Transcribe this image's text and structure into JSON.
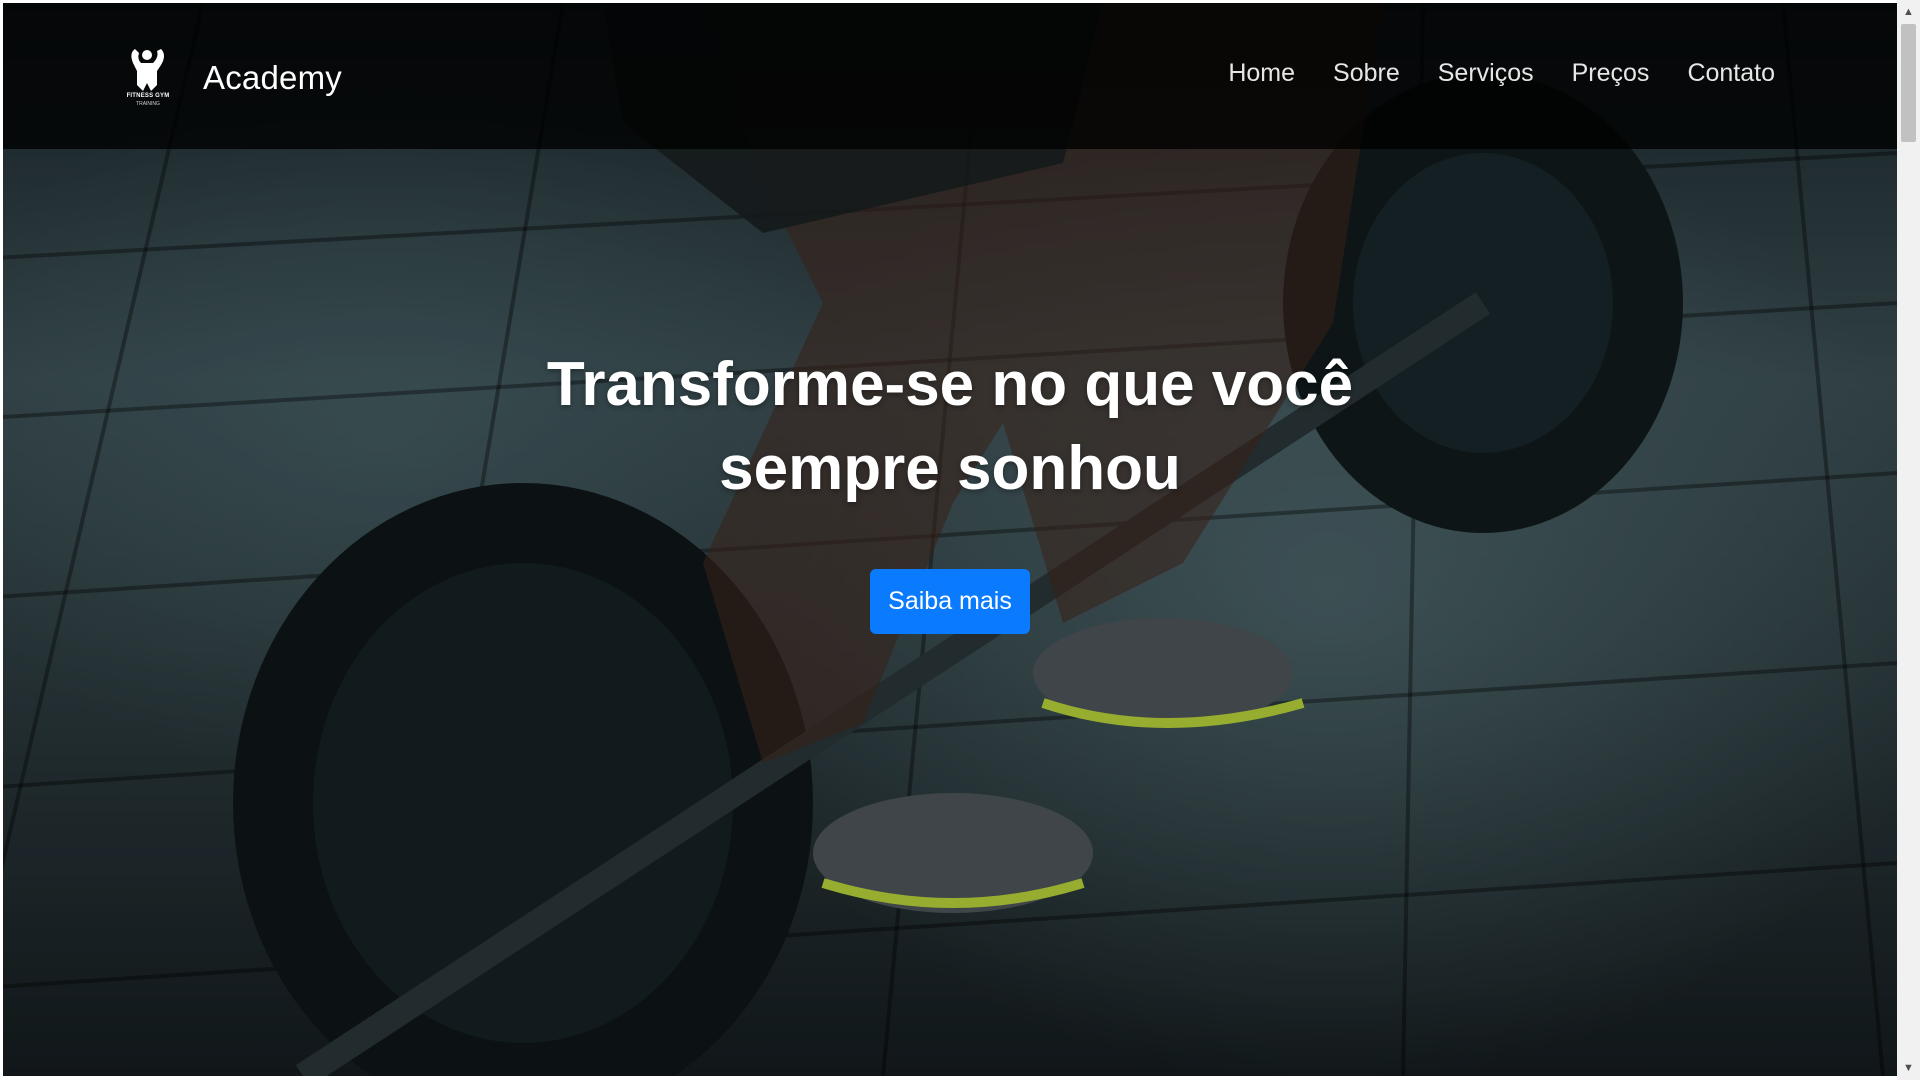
{
  "navbar": {
    "logo": {
      "icon": "bodybuilder-icon",
      "line1": "FITNESS GYM",
      "line2": "TRAINING"
    },
    "brand": "Academy",
    "links": [
      "Home",
      "Sobre",
      "Serviços",
      "Preços",
      "Contato"
    ]
  },
  "hero": {
    "title_line1": "Transforme-se no que você",
    "title_line2": "sempre sonhou",
    "cta_label": "Saiba mais",
    "cta_color": "#0a7bff"
  },
  "scrollbar": {
    "up_icon": "chevron-up-icon",
    "down_icon": "chevron-down-icon"
  }
}
